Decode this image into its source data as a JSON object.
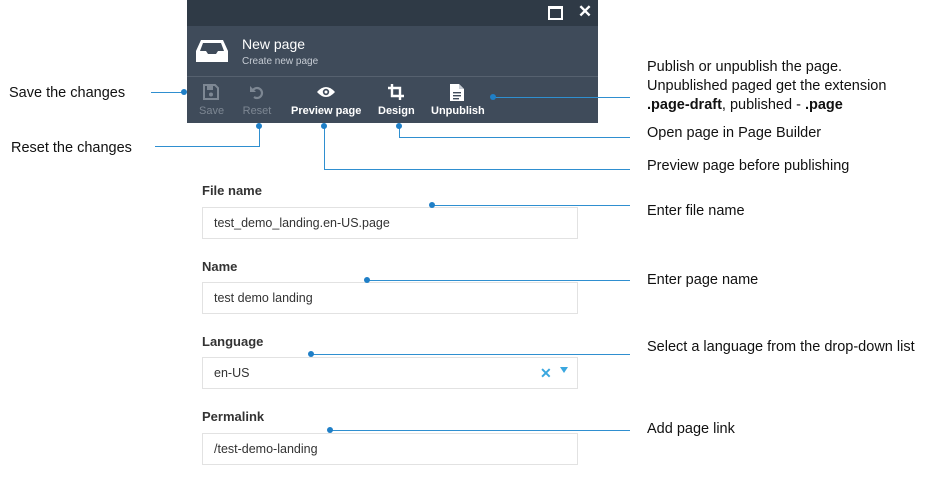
{
  "dialog": {
    "title": "New page",
    "subtitle": "Create new page",
    "toolbar": {
      "save": "Save",
      "reset": "Reset",
      "preview": "Preview page",
      "design": "Design",
      "unpublish": "Unpublish"
    }
  },
  "form": {
    "file_name_label": "File name",
    "file_name_value": "test_demo_landing.en-US.page",
    "name_label": "Name",
    "name_value": "test demo landing",
    "language_label": "Language",
    "language_value": "en-US",
    "permalink_label": "Permalink",
    "permalink_value": "/test-demo-landing"
  },
  "callouts": {
    "save": "Save the changes",
    "reset": "Reset the changes",
    "publish_line1": "Publish or unpublish the page.",
    "publish_line2": "Unpublished paged get the extension",
    "publish_ext_draft": ".page-draft",
    "publish_mid": ", published - ",
    "publish_ext": ".page",
    "design": "Open page in Page Builder",
    "preview": "Preview page before publishing",
    "file_name": "Enter file name",
    "name": "Enter page name",
    "language": "Select a language from the drop-down list",
    "permalink": "Add page link"
  },
  "colors": {
    "header_bg": "#3f4b5a",
    "titlebar_bg": "#2f3a46",
    "callout_line": "#2f8fd0",
    "accent": "#3aa7df"
  }
}
